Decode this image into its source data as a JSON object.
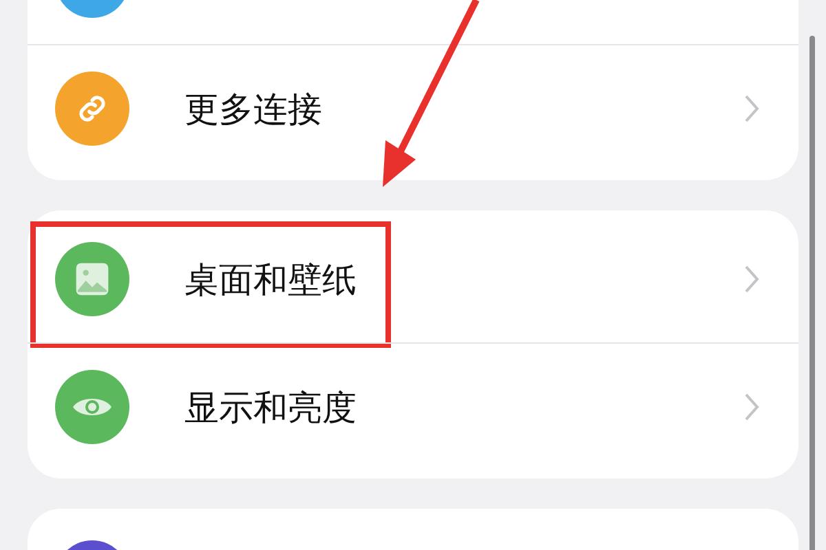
{
  "groups": [
    {
      "items": [
        {
          "kind": "blank",
          "color": "#3ea8e6",
          "highlighted": false
        },
        {
          "label": "更多连接",
          "kind": "link",
          "color": "#f4a42c",
          "highlighted": false
        }
      ]
    },
    {
      "items": [
        {
          "label": "桌面和壁纸",
          "kind": "image",
          "color": "#5cb85c",
          "highlighted": true
        },
        {
          "label": "显示和亮度",
          "kind": "eye",
          "color": "#5cb85c",
          "highlighted": false
        }
      ]
    },
    {
      "items": [
        {
          "kind": "blank",
          "color": "#5b4fd0",
          "highlighted": false
        }
      ]
    }
  ],
  "annotation_arrow": true
}
